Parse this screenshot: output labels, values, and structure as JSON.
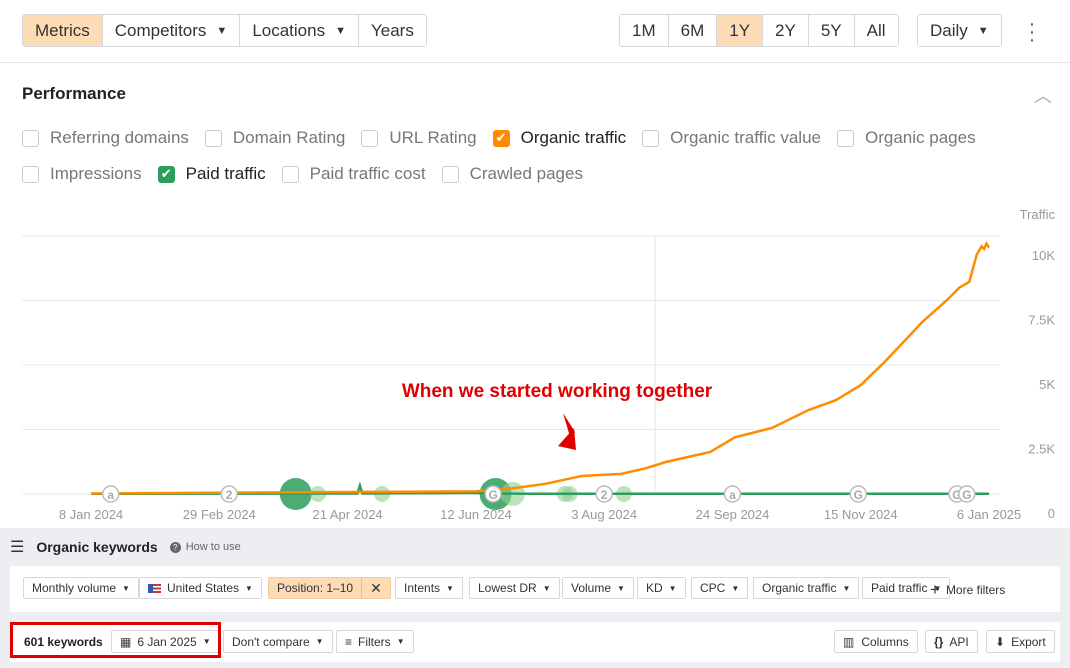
{
  "toolbar": {
    "tabs": [
      {
        "label": "Metrics",
        "active": true
      },
      {
        "label": "Competitors",
        "dropdown": true
      },
      {
        "label": "Locations",
        "dropdown": true
      },
      {
        "label": "Years"
      }
    ],
    "ranges": [
      {
        "label": "1M"
      },
      {
        "label": "6M"
      },
      {
        "label": "1Y",
        "active": true
      },
      {
        "label": "2Y"
      },
      {
        "label": "5Y"
      },
      {
        "label": "All"
      }
    ],
    "interval": "Daily"
  },
  "performance": {
    "title": "Performance",
    "metrics_row1": [
      {
        "label": "Referring domains",
        "checked": false
      },
      {
        "label": "Domain Rating",
        "checked": false
      },
      {
        "label": "URL Rating",
        "checked": false
      },
      {
        "label": "Organic traffic",
        "checked": true,
        "color": "#ff8c00"
      },
      {
        "label": "Organic traffic value",
        "checked": false
      },
      {
        "label": "Organic pages",
        "checked": false
      }
    ],
    "metrics_row2": [
      {
        "label": "Impressions",
        "checked": false
      },
      {
        "label": "Paid traffic",
        "checked": true,
        "color": "#2e9e5b"
      },
      {
        "label": "Paid traffic cost",
        "checked": false
      },
      {
        "label": "Crawled pages",
        "checked": false
      }
    ]
  },
  "chart_data": {
    "type": "line",
    "ylabel": "Traffic",
    "ylim": [
      0,
      10000
    ],
    "yticks": [
      "0",
      "2.5K",
      "5K",
      "7.5K",
      "10K"
    ],
    "xlim": [
      "2024-01-08",
      "2025-01-06"
    ],
    "xticks": [
      "8 Jan 2024",
      "29 Feb 2024",
      "21 Apr 2024",
      "12 Jun 2024",
      "3 Aug 2024",
      "24 Sep 2024",
      "15 Nov 2024",
      "6 Jan 2025"
    ],
    "grid": true,
    "annotation": "When we started working together",
    "annotation_color": "#e00000",
    "series": [
      {
        "name": "Organic traffic",
        "color": "#ff8c00",
        "points": [
          [
            "2024-01-08",
            20
          ],
          [
            "2024-03-15",
            60
          ],
          [
            "2024-05-01",
            80
          ],
          [
            "2024-06-12",
            100
          ],
          [
            "2024-06-25",
            200
          ],
          [
            "2024-07-10",
            390
          ],
          [
            "2024-07-25",
            700
          ],
          [
            "2024-08-10",
            780
          ],
          [
            "2024-08-20",
            1000
          ],
          [
            "2024-08-28",
            1240
          ],
          [
            "2024-09-15",
            1630
          ],
          [
            "2024-09-25",
            2200
          ],
          [
            "2024-10-10",
            2560
          ],
          [
            "2024-10-25",
            3260
          ],
          [
            "2024-11-05",
            3640
          ],
          [
            "2024-11-15",
            4220
          ],
          [
            "2024-11-25",
            5150
          ],
          [
            "2024-12-05",
            6160
          ],
          [
            "2024-12-10",
            6670
          ],
          [
            "2024-12-20",
            7520
          ],
          [
            "2024-12-25",
            8000
          ],
          [
            "2024-12-29",
            8220
          ],
          [
            "2025-01-01",
            9270
          ],
          [
            "2025-01-03",
            9600
          ],
          [
            "2025-01-04",
            9500
          ],
          [
            "2025-01-05",
            9700
          ],
          [
            "2025-01-06",
            9550
          ]
        ]
      },
      {
        "name": "Paid traffic",
        "color": "#2e9e5b",
        "points": [
          [
            "2024-01-08",
            10
          ],
          [
            "2024-04-25",
            20
          ],
          [
            "2024-04-26",
            330
          ],
          [
            "2024-04-27",
            20
          ],
          [
            "2024-06-10",
            40
          ],
          [
            "2024-06-30",
            10
          ],
          [
            "2025-01-06",
            10
          ]
        ]
      }
    ],
    "events": [
      [
        "2024-01-16",
        "a"
      ],
      [
        "2024-03-04",
        "2"
      ],
      [
        "2024-06-19",
        "G"
      ],
      [
        "2024-08-03",
        "2"
      ],
      [
        "2024-09-24",
        "a"
      ],
      [
        "2024-11-14",
        "G"
      ],
      [
        "2024-12-24",
        "G"
      ],
      [
        "2024-12-28",
        "G"
      ]
    ],
    "bubbles": [
      [
        "2024-03-31",
        3
      ],
      [
        "2024-04-09",
        1
      ],
      [
        "2024-05-05",
        1
      ],
      [
        "2024-06-20",
        3
      ],
      [
        "2024-06-27",
        2
      ],
      [
        "2024-07-18",
        1
      ],
      [
        "2024-07-20",
        1
      ],
      [
        "2024-08-11",
        1
      ]
    ]
  },
  "keywords": {
    "title": "Organic keywords",
    "help": "How to use",
    "filters": [
      {
        "label": "Monthly volume"
      },
      {
        "label": "United States",
        "flag": true
      },
      {
        "label": "Position: 1–10",
        "active": true
      },
      {
        "label": "Intents"
      },
      {
        "label": "Lowest DR"
      },
      {
        "label": "Volume"
      },
      {
        "label": "KD"
      },
      {
        "label": "CPC"
      },
      {
        "label": "Organic traffic"
      },
      {
        "label": "Paid traffic"
      }
    ],
    "more_filters": "More filters",
    "count": "601 keywords",
    "date": "6 Jan 2025",
    "compare": "Don't compare",
    "filters_btn": "Filters",
    "columns": "Columns",
    "api": "API",
    "export": "Export"
  }
}
